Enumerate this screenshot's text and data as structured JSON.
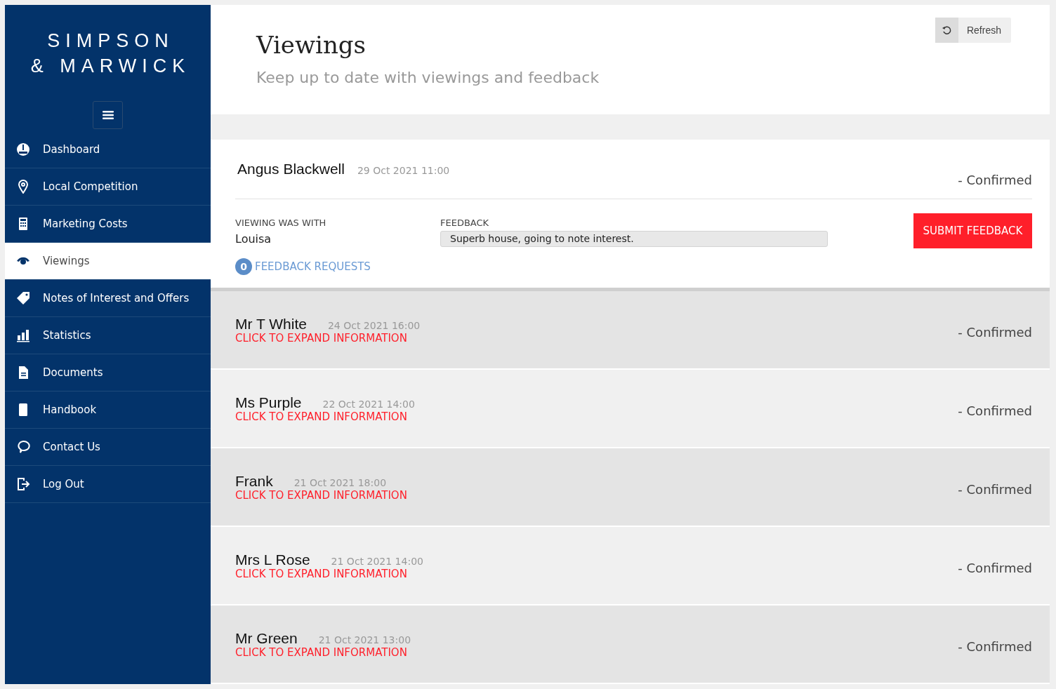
{
  "brand": {
    "line_1": "SIMPSON",
    "line_2": "& MARWICK"
  },
  "sidebar": {
    "items": [
      {
        "label": "Dashboard",
        "selected": false
      },
      {
        "label": "Local Competition",
        "selected": false
      },
      {
        "label": "Marketing Costs",
        "selected": false
      },
      {
        "label": "Viewings",
        "selected": true
      },
      {
        "label": "Notes of Interest and Offers",
        "selected": false
      },
      {
        "label": "Statistics",
        "selected": false
      },
      {
        "label": "Documents",
        "selected": false
      },
      {
        "label": "Handbook",
        "selected": false
      },
      {
        "label": "Contact Us",
        "selected": false
      },
      {
        "label": "Log Out",
        "selected": false
      }
    ]
  },
  "header": {
    "title": "Viewings",
    "subtitle": "Keep up to date with viewings and feedback",
    "refresh_button": "Refresh"
  },
  "viewings": [
    {
      "name": "Angus Blackwell",
      "date": "29 Oct 2021 11:00",
      "status": "- Confirmed",
      "expanded": true,
      "with_label": "VIEWING WAS WITH",
      "with_value": "Louisa",
      "feedback_label": "FEEDBACK",
      "feedback_value": "Superb house, going to note interest.",
      "submit_button": "SUBMIT FEEDBACK",
      "requests_count": "0",
      "requests_label": "FEEDBACK REQUESTS"
    },
    {
      "name": "Mr T White",
      "date": "24 Oct 2021 16:00",
      "status": "- Confirmed",
      "expanded": false,
      "expand_hint": "CLICK TO EXPAND INFORMATION"
    },
    {
      "name": "Ms Purple",
      "date": "22 Oct 2021 14:00",
      "status": "- Confirmed",
      "expanded": false,
      "expand_hint": "CLICK TO EXPAND INFORMATION"
    },
    {
      "name": "Frank",
      "date": "21 Oct 2021 18:00",
      "status": "- Confirmed",
      "expanded": false,
      "expand_hint": "CLICK TO EXPAND INFORMATION"
    },
    {
      "name": "Mrs L Rose",
      "date": "21 Oct 2021 14:00",
      "status": "- Confirmed",
      "expanded": false,
      "expand_hint": "CLICK TO EXPAND INFORMATION"
    },
    {
      "name": "Mr Green",
      "date": "21 Oct 2021 13:00",
      "status": "- Confirmed",
      "expanded": false,
      "expand_hint": "CLICK TO EXPAND INFORMATION"
    }
  ]
}
